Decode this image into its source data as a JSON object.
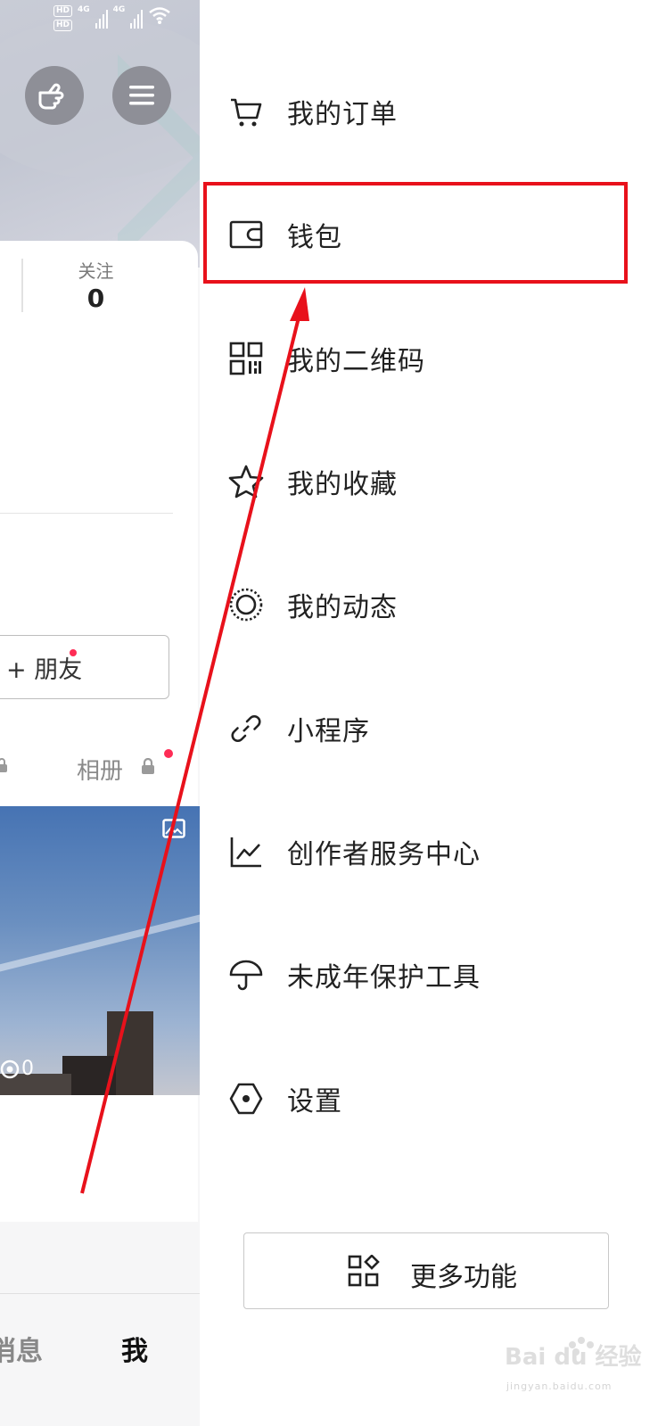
{
  "status_bar": {
    "hd1": "HD",
    "hd2": "HD",
    "net1": "4G",
    "net2": "4G"
  },
  "profile": {
    "follow_label": "关注",
    "follow_count": "0",
    "friend_button": "+ 朋友",
    "album_tab": "相册",
    "view_count": "0"
  },
  "bottom_nav": {
    "messages": "消息",
    "me": "我"
  },
  "drawer": {
    "items": [
      {
        "label": "我的订单",
        "icon": "cart-icon"
      },
      {
        "label": "钱包",
        "icon": "wallet-icon"
      },
      {
        "label": "我的二维码",
        "icon": "qrcode-icon"
      },
      {
        "label": "我的收藏",
        "icon": "star-icon"
      },
      {
        "label": "我的动态",
        "icon": "moments-icon"
      },
      {
        "label": "小程序",
        "icon": "link-icon"
      },
      {
        "label": "创作者服务中心",
        "icon": "chart-icon"
      },
      {
        "label": "未成年保护工具",
        "icon": "umbrella-icon"
      },
      {
        "label": "设置",
        "icon": "hexagon-settings-icon"
      }
    ],
    "more_button": "更多功能"
  },
  "annotation": {
    "highlight_color": "#e8111b"
  },
  "watermark": {
    "text": "jingyan.baidu.com",
    "logo_text": "Bai du 经验"
  }
}
